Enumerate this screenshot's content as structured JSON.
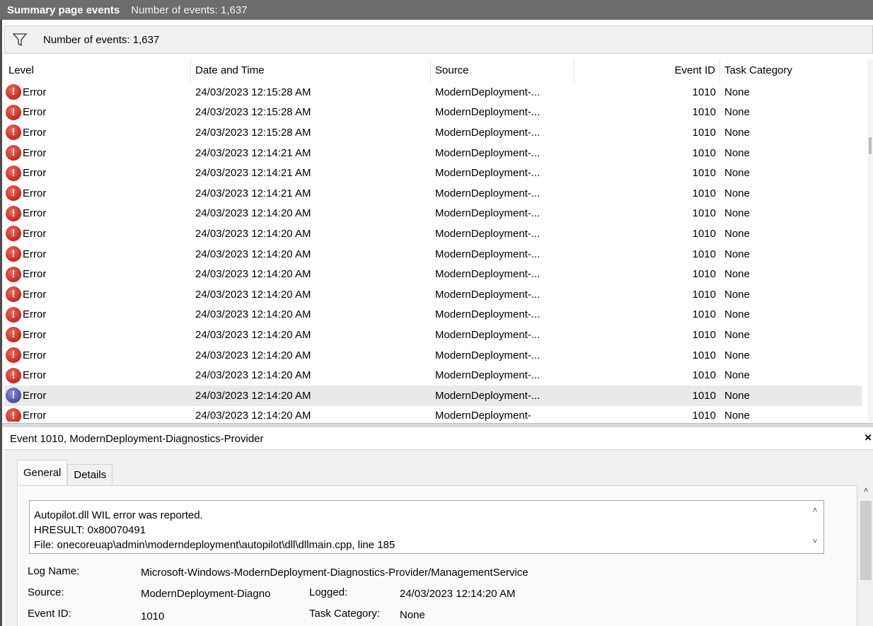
{
  "titlebar": {
    "title": "Summary page events",
    "count_text": "Number of events: 1,637"
  },
  "filter": {
    "icon": "filter-funnel-icon",
    "count_text": "Number of events: 1,637"
  },
  "table": {
    "columns": [
      "Level",
      "Date and Time",
      "Source",
      "Event ID",
      "Task Category"
    ],
    "rows": [
      {
        "level": "Error",
        "date": "24/03/2023 12:15:28 AM",
        "source": "ModernDeployment-...",
        "event_id": "1010",
        "category": "None"
      },
      {
        "level": "Error",
        "date": "24/03/2023 12:15:28 AM",
        "source": "ModernDeployment-...",
        "event_id": "1010",
        "category": "None"
      },
      {
        "level": "Error",
        "date": "24/03/2023 12:15:28 AM",
        "source": "ModernDeployment-...",
        "event_id": "1010",
        "category": "None"
      },
      {
        "level": "Error",
        "date": "24/03/2023 12:14:21 AM",
        "source": "ModernDeployment-...",
        "event_id": "1010",
        "category": "None"
      },
      {
        "level": "Error",
        "date": "24/03/2023 12:14:21 AM",
        "source": "ModernDeployment-...",
        "event_id": "1010",
        "category": "None"
      },
      {
        "level": "Error",
        "date": "24/03/2023 12:14:21 AM",
        "source": "ModernDeployment-...",
        "event_id": "1010",
        "category": "None"
      },
      {
        "level": "Error",
        "date": "24/03/2023 12:14:20 AM",
        "source": "ModernDeployment-...",
        "event_id": "1010",
        "category": "None"
      },
      {
        "level": "Error",
        "date": "24/03/2023 12:14:20 AM",
        "source": "ModernDeployment-...",
        "event_id": "1010",
        "category": "None"
      },
      {
        "level": "Error",
        "date": "24/03/2023 12:14:20 AM",
        "source": "ModernDeployment-...",
        "event_id": "1010",
        "category": "None"
      },
      {
        "level": "Error",
        "date": "24/03/2023 12:14:20 AM",
        "source": "ModernDeployment-...",
        "event_id": "1010",
        "category": "None"
      },
      {
        "level": "Error",
        "date": "24/03/2023 12:14:20 AM",
        "source": "ModernDeployment-...",
        "event_id": "1010",
        "category": "None"
      },
      {
        "level": "Error",
        "date": "24/03/2023 12:14:20 AM",
        "source": "ModernDeployment-...",
        "event_id": "1010",
        "category": "None"
      },
      {
        "level": "Error",
        "date": "24/03/2023 12:14:20 AM",
        "source": "ModernDeployment-...",
        "event_id": "1010",
        "category": "None"
      },
      {
        "level": "Error",
        "date": "24/03/2023 12:14:20 AM",
        "source": "ModernDeployment-...",
        "event_id": "1010",
        "category": "None"
      },
      {
        "level": "Error",
        "date": "24/03/2023 12:14:20 AM",
        "source": "ModernDeployment-...",
        "event_id": "1010",
        "category": "None"
      },
      {
        "level": "Error",
        "date": "24/03/2023 12:14:20 AM",
        "source": "ModernDeployment-...",
        "event_id": "1010",
        "category": "None",
        "selected": true
      },
      {
        "level": "Error",
        "date": "24/03/2023 12:14:20 AM",
        "source": "ModernDeployment-",
        "event_id": "1010",
        "category": "None"
      }
    ]
  },
  "details": {
    "header": "Event 1010, ModernDeployment-Diagnostics-Provider",
    "close_glyph": "×",
    "tabs": [
      "General",
      "Details"
    ],
    "message_lines": [
      "Autopilot.dll WIL error was reported.",
      "HRESULT: 0x80070491",
      "File: onecoreuap\\admin\\moderndeployment\\autopilot\\dll\\dllmain.cpp, line 185"
    ],
    "log_name_label": "Log Name:",
    "log_name_value": "Microsoft-Windows-ModernDeployment-Diagnostics-Provider/ManagementService",
    "source_label": "Source:",
    "source_value": "ModernDeployment-Diagno",
    "logged_label": "Logged:",
    "logged_value": "24/03/2023 12:14:20 AM",
    "event_id_label": "Event ID:",
    "event_id_value": "1010",
    "task_category_label": "Task Category:",
    "task_category_value": "None"
  }
}
